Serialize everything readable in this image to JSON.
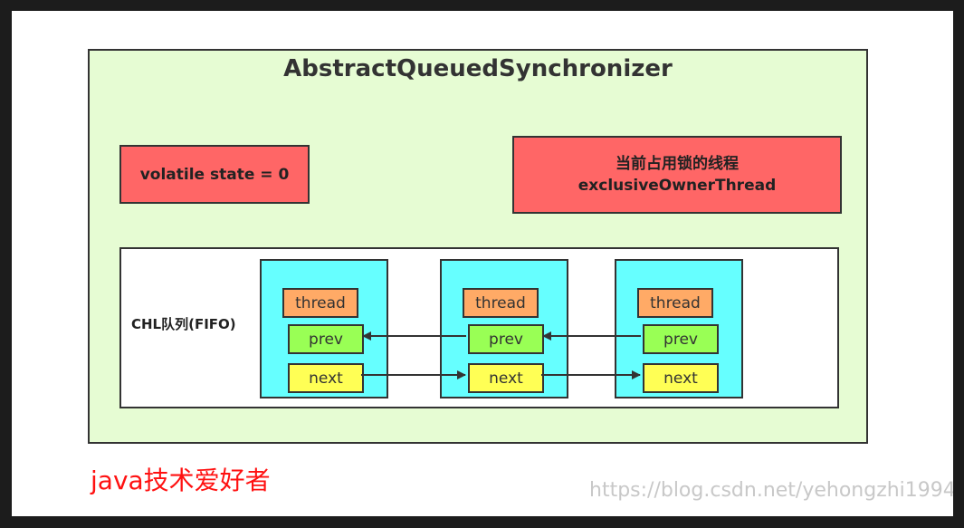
{
  "title": "AbstractQueuedSynchronizer",
  "state_box": {
    "text": "volatile state = 0"
  },
  "owner_box": {
    "line1": "当前占用锁的线程",
    "line2": "exclusiveOwnerThread"
  },
  "queue": {
    "label": "CHL队列(FIFO)",
    "nodes": [
      {
        "thread": "thread",
        "prev": "prev",
        "next": "next"
      },
      {
        "thread": "thread",
        "prev": "prev",
        "next": "next"
      },
      {
        "thread": "thread",
        "prev": "prev",
        "next": "next"
      }
    ]
  },
  "footer": {
    "brand": "java技术爱好者",
    "watermark": "https://blog.csdn.net/yehongzhi1994"
  },
  "colors": {
    "container": "#e6fcd3",
    "red_box": "#ff6666",
    "node": "#66ffff",
    "thread_field": "#ffaa66",
    "prev_field": "#99ff55",
    "next_field": "#ffff55"
  }
}
